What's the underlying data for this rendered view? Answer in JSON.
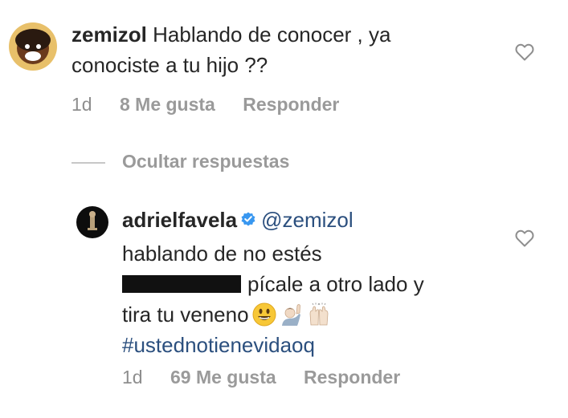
{
  "comment1": {
    "username": "zemizol",
    "text_line1": "Hablando de conocer , ya",
    "text_line2": "conociste a tu hijo ??",
    "time": "1d",
    "likes": "8 Me gusta",
    "reply": "Responder"
  },
  "thread": {
    "hide_replies": "Ocultar respuestas"
  },
  "reply1": {
    "username": "adrielfavela",
    "mention": "@zemizol",
    "text_line1": "hablando de no estés",
    "text_line2_after": "pícale a otro lado y",
    "text_line3": "tira tu veneno",
    "hashtag": "#ustednotienevidaoq",
    "time": "1d",
    "likes": "69 Me gusta",
    "reply": "Responder",
    "verified_color": "#3897f0"
  },
  "icons": {
    "like": "heart-outline-icon",
    "verified": "verified-badge-icon",
    "emoji1": "smiling-face-emoji",
    "emoji2": "person-raising-hand-emoji",
    "emoji3": "raising-hands-emoji"
  }
}
